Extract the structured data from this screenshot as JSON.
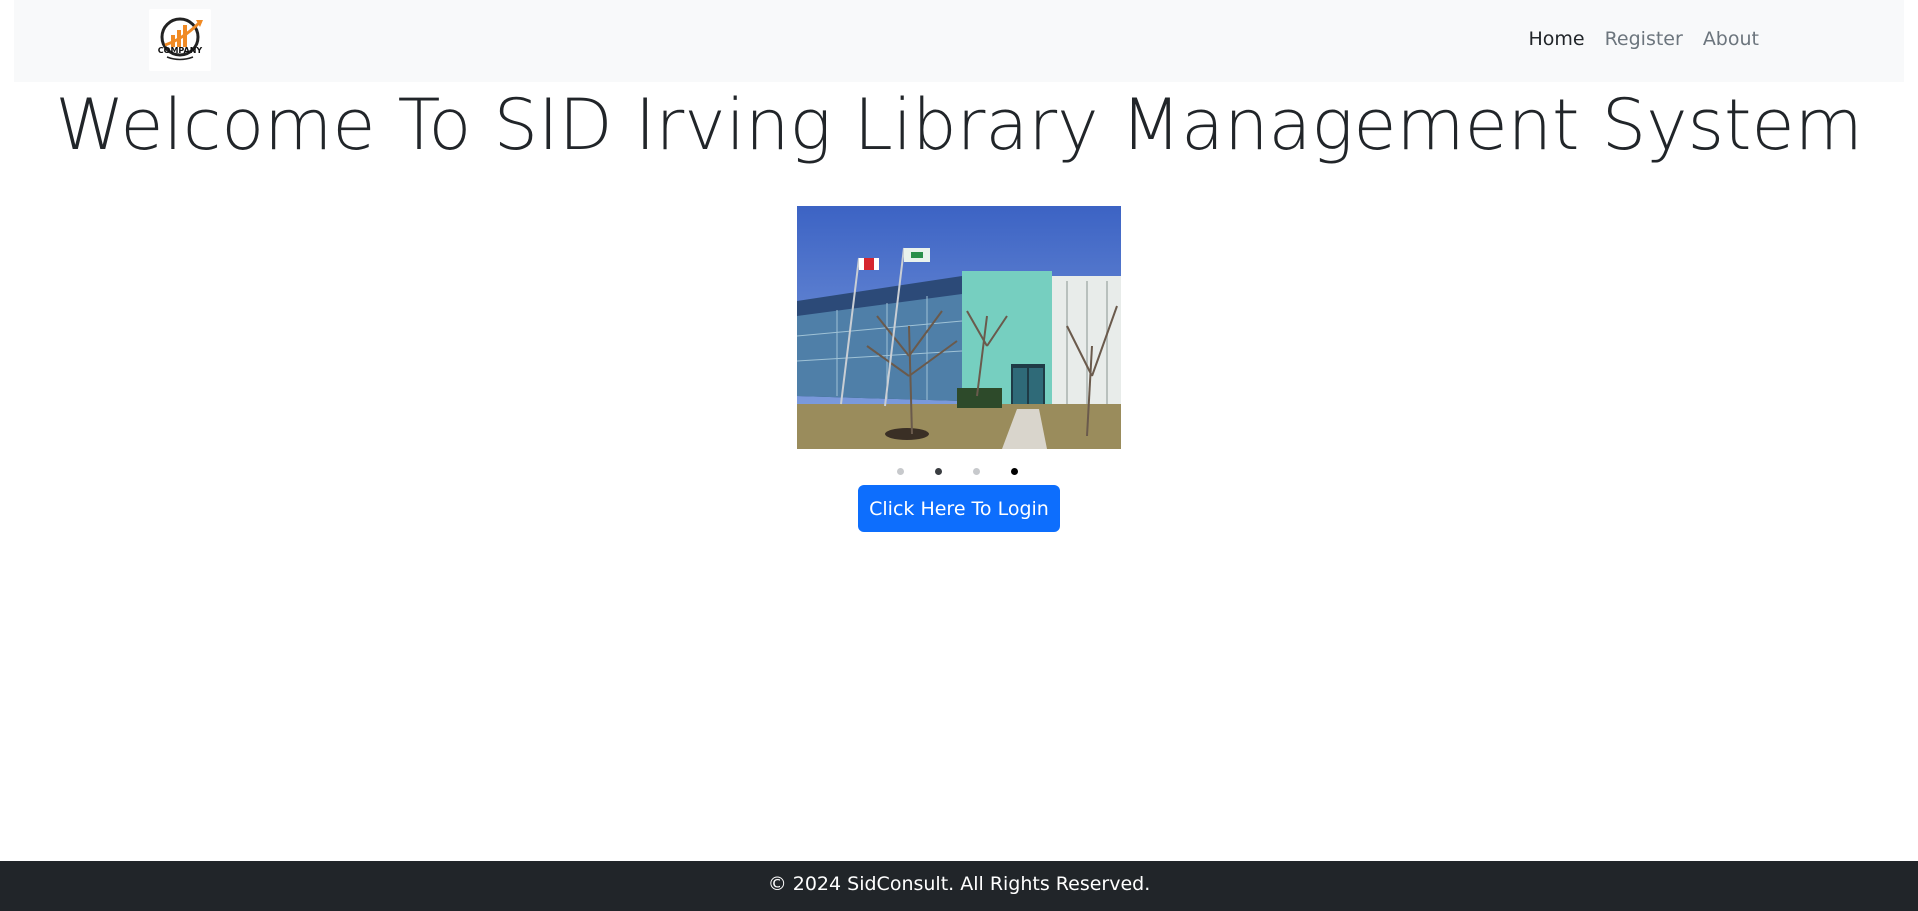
{
  "navbar": {
    "logo_text": "COMPANY",
    "links": [
      {
        "label": "Home",
        "active": true
      },
      {
        "label": "Register",
        "active": false
      },
      {
        "label": "About",
        "active": false
      }
    ]
  },
  "main": {
    "title": "Welcome To SID Irving Library Management System",
    "carousel": {
      "slide_count": 4,
      "active_index": 3
    },
    "login_button": "Click Here To Login"
  },
  "footer": {
    "text": "© 2024 SidConsult. All Rights Reserved."
  },
  "colors": {
    "primary": "#0d6efd",
    "navbar_bg": "#f8f9fa",
    "footer_bg": "#212529",
    "text": "#212529",
    "muted": "#6c757d"
  }
}
